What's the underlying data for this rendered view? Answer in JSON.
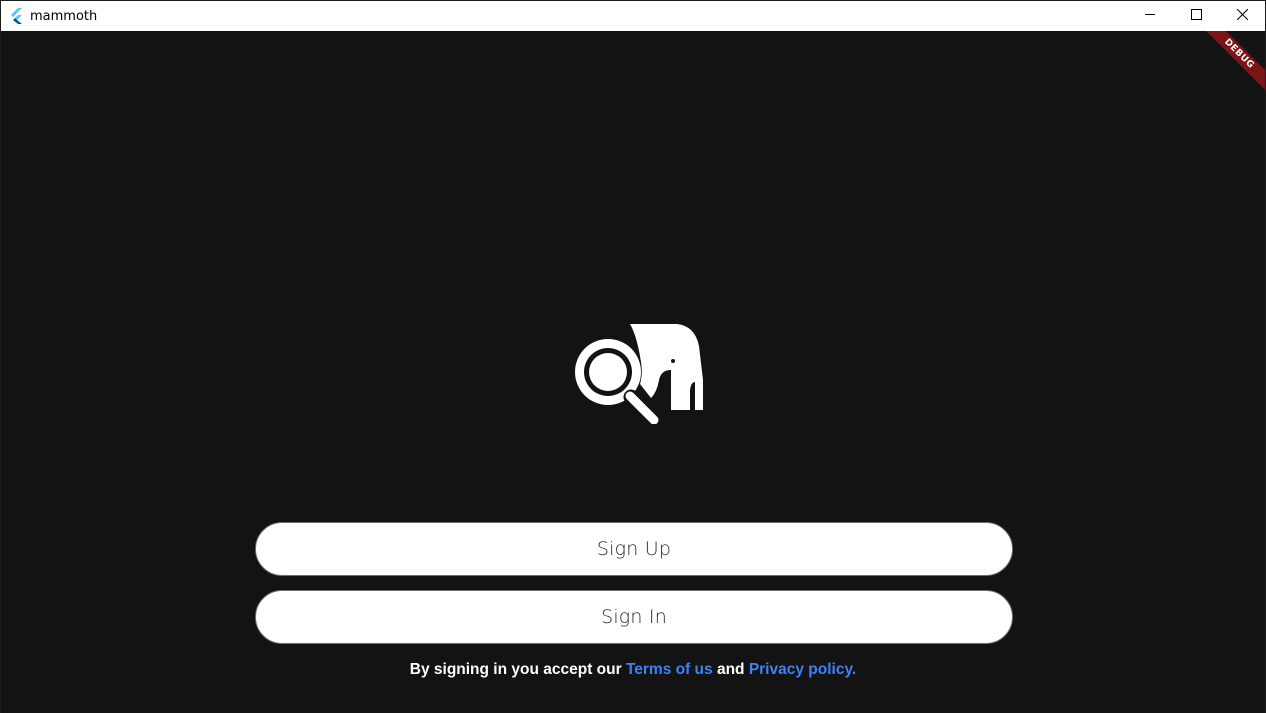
{
  "window": {
    "title": "mammoth",
    "controls": {
      "minimize_icon": "minimize-icon",
      "maximize_icon": "maximize-icon",
      "close_icon": "close-icon"
    }
  },
  "debug_banner": "DEBUG",
  "logo": {
    "icon": "mammoth-magnifier-logo",
    "color": "#ffffff"
  },
  "buttons": {
    "sign_up": "Sign Up",
    "sign_in": "Sign In"
  },
  "legal": {
    "prefix": "By signing in you accept our ",
    "terms": "Terms of us",
    "and": " and ",
    "privacy": "Privacy policy."
  },
  "colors": {
    "background": "#131313",
    "link": "#3b82f6",
    "debug": "#7a1616",
    "button_bg": "#ffffff"
  }
}
